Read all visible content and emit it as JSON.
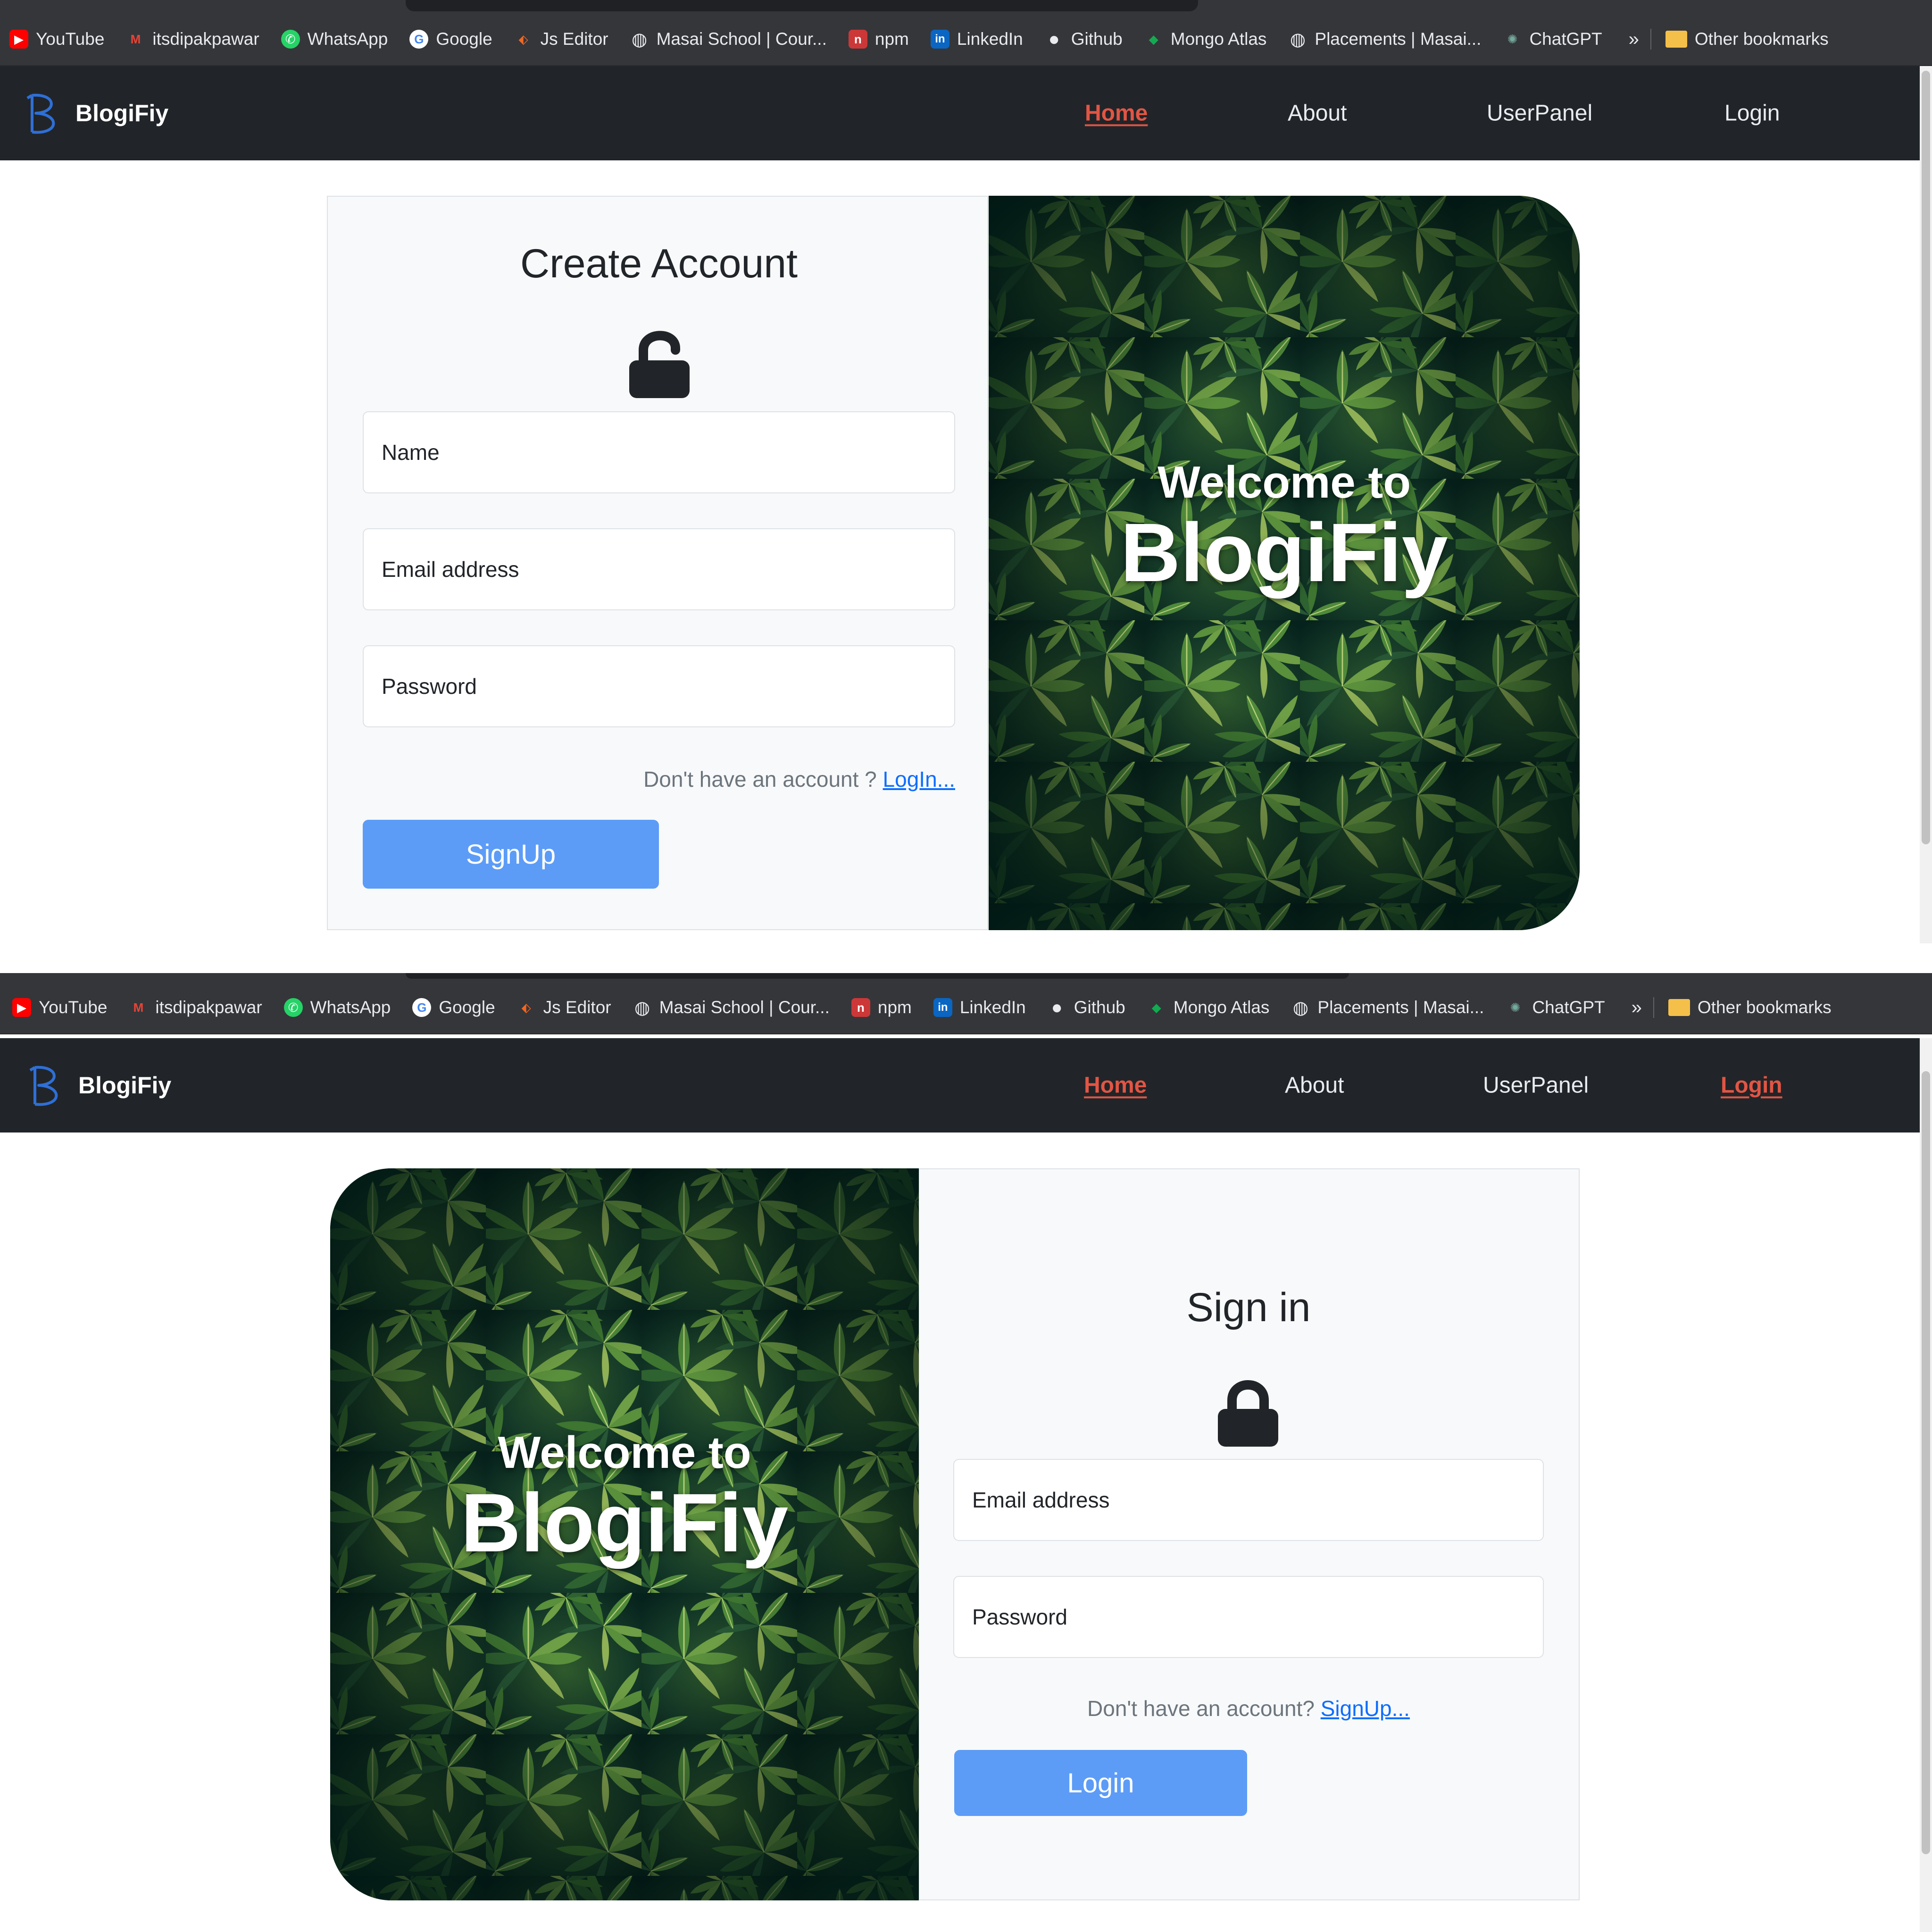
{
  "bookmarks": {
    "items": [
      {
        "label": "YouTube",
        "icon": "youtube-icon",
        "color": "#ff0000",
        "glyph": "▶"
      },
      {
        "label": "itsdipakpawar",
        "icon": "gmail-icon",
        "color": "#ea4335",
        "glyph": "M"
      },
      {
        "label": "WhatsApp",
        "icon": "whatsapp-icon",
        "color": "#25d366",
        "glyph": "✆"
      },
      {
        "label": "Google",
        "icon": "google-icon",
        "color": "#ffffff",
        "glyph": "G"
      },
      {
        "label": "Js Editor",
        "icon": "js-editor-icon",
        "color": "#f26722",
        "glyph": "⬖"
      },
      {
        "label": "Masai School | Cour...",
        "icon": "globe-icon",
        "color": "#e8eaed",
        "glyph": "◍"
      },
      {
        "label": "npm",
        "icon": "npm-icon",
        "color": "#cb3837",
        "glyph": "n"
      },
      {
        "label": "LinkedIn",
        "icon": "linkedin-icon",
        "color": "#0a66c2",
        "glyph": "in"
      },
      {
        "label": "Github",
        "icon": "github-icon",
        "color": "#e8eaed",
        "glyph": "●"
      },
      {
        "label": "Mongo Atlas",
        "icon": "mongodb-icon",
        "color": "#13aa52",
        "glyph": "◆"
      },
      {
        "label": "Placements | Masai...",
        "icon": "globe-icon",
        "color": "#e8eaed",
        "glyph": "◍"
      },
      {
        "label": "ChatGPT",
        "icon": "chatgpt-icon",
        "color": "#74aa9c",
        "glyph": "✺"
      }
    ],
    "more": "»",
    "other": "Other bookmarks"
  },
  "navbar": {
    "brand": "BlogiFiy",
    "links": {
      "home": "Home",
      "about": "About",
      "userpanel": "UserPanel",
      "login": "Login"
    }
  },
  "colors": {
    "active_link": "#e25544",
    "navbar_bg": "#212529",
    "button_bg": "#5c9cf7",
    "link": "#0d6efd"
  },
  "signup": {
    "title": "Create Account",
    "lock_icon": "unlocked-padlock-icon",
    "name_placeholder": "Name",
    "email_placeholder": "Email address",
    "password_placeholder": "Password",
    "hint_text": "Don't have an account ? ",
    "hint_link": "LogIn...",
    "button": "SignUp",
    "welcome_line1": "Welcome to",
    "welcome_line2": "BlogiFiy"
  },
  "signin": {
    "title": "Sign in",
    "lock_icon": "locked-padlock-icon",
    "email_placeholder": "Email address",
    "password_placeholder": "Password",
    "hint_text": "Don't have an account? ",
    "hint_link": "SignUp...",
    "button": "Login",
    "welcome_line1": "Welcome to",
    "welcome_line2": "BlogiFiy"
  }
}
